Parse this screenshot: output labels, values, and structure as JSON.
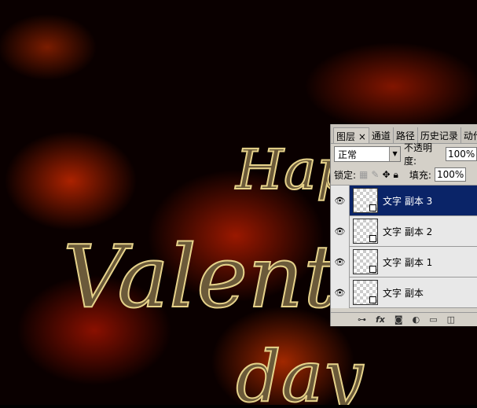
{
  "artwork": {
    "text_lines": [
      "Happy",
      "Valentine",
      "day"
    ]
  },
  "panel": {
    "tabs": [
      {
        "label": "图层 ×",
        "active": true
      },
      {
        "label": "通道"
      },
      {
        "label": "路径"
      },
      {
        "label": "历史记录"
      },
      {
        "label": "动作"
      }
    ],
    "blend_mode": "正常",
    "opacity_label": "不透明度:",
    "opacity": "100%",
    "lock_label": "锁定:",
    "fill_label": "填充:",
    "fill": "100%",
    "layers": [
      {
        "name": "文字 副本 3",
        "selected": true
      },
      {
        "name": "文字 副本 2"
      },
      {
        "name": "文字 副本 1"
      },
      {
        "name": "文字 副本"
      }
    ],
    "footer_icons": [
      "link-icon",
      "fx-icon",
      "mask-icon",
      "adjustment-icon",
      "folder-icon",
      "new-layer-icon"
    ],
    "fx_label": "fx"
  }
}
